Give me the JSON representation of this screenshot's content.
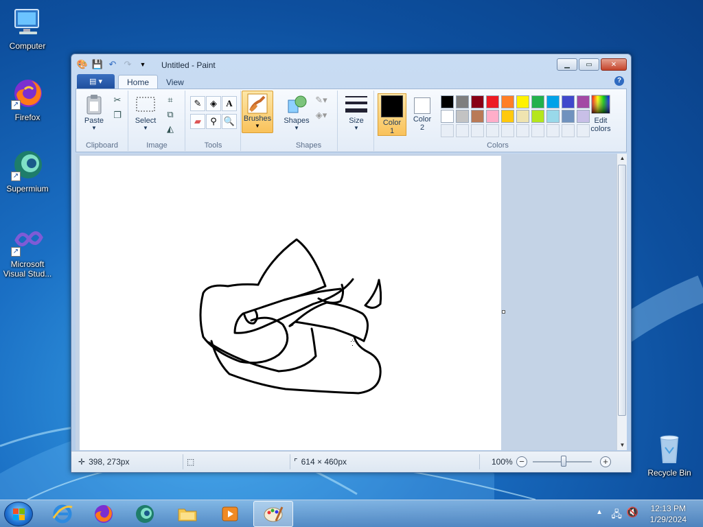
{
  "desktop": {
    "icons": [
      {
        "label": "Computer"
      },
      {
        "label": "Firefox"
      },
      {
        "label": "Supermium"
      },
      {
        "label_line1": "Microsoft",
        "label_line2": "Visual Stud..."
      },
      {
        "label": "Recycle Bin"
      }
    ]
  },
  "window": {
    "title": "Untitled - Paint",
    "tabs": [
      "Home",
      "View"
    ],
    "help": "?",
    "ribbon": {
      "clipboard": {
        "label": "Clipboard",
        "paste": "Paste"
      },
      "image": {
        "label": "Image",
        "select": "Select"
      },
      "tools": {
        "label": "Tools"
      },
      "brushes": {
        "label": "Brushes"
      },
      "shapes": {
        "label": "Shapes",
        "shapes_btn": "Shapes"
      },
      "size": {
        "label": "Size"
      },
      "colors": {
        "label": "Colors",
        "color1_line1": "Color",
        "color1_line2": "1",
        "color2_line1": "Color",
        "color2_line2": "2",
        "edit_line1": "Edit",
        "edit_line2": "colors",
        "color1_value": "#000000",
        "color2_value": "#ffffff",
        "palette_row1": [
          "#000000",
          "#7f7f7f",
          "#880015",
          "#ed1c24",
          "#ff7f27",
          "#fff200",
          "#22b14c",
          "#00a2e8",
          "#3f48cc",
          "#a349a4"
        ],
        "palette_row2": [
          "#ffffff",
          "#c3c3c3",
          "#b97a57",
          "#ffaec9",
          "#ffc90e",
          "#efe4b0",
          "#b5e61d",
          "#99d9ea",
          "#7092be",
          "#c8bfe7"
        ]
      }
    },
    "status": {
      "cursor_pos": "398, 273px",
      "canvas_size": "614 × 460px",
      "zoom": "100%"
    }
  },
  "taskbar": {
    "time": "12:13 PM",
    "date": "1/29/2024"
  }
}
